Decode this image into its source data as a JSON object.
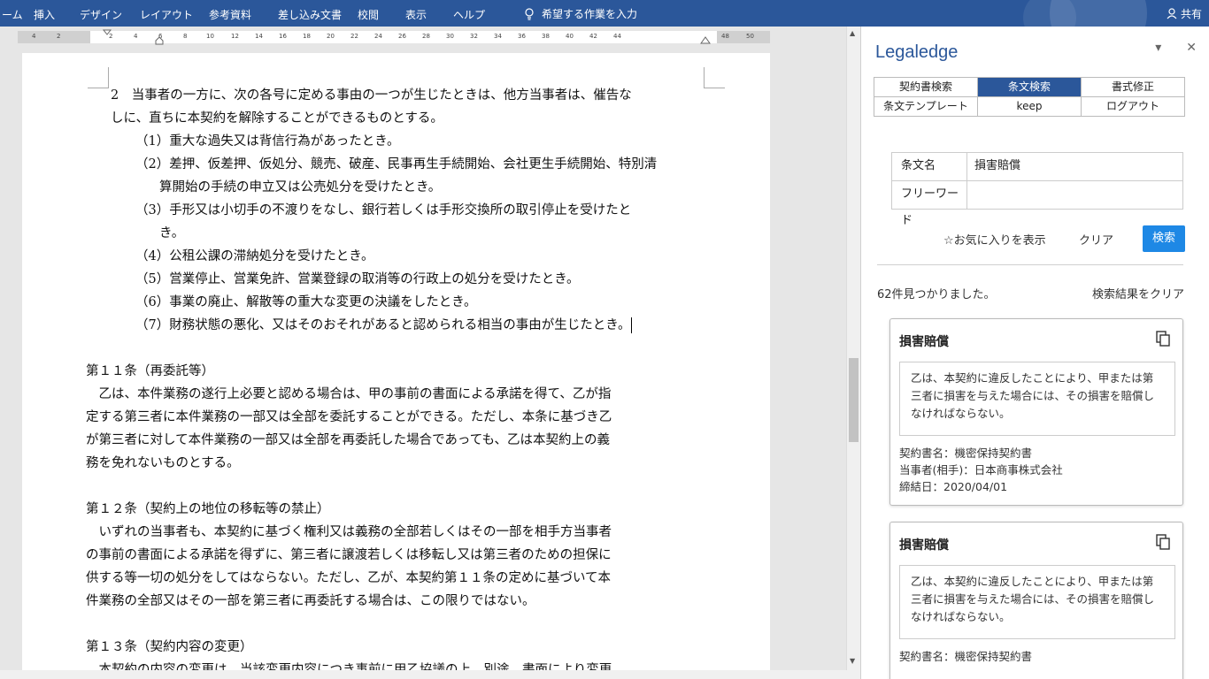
{
  "ribbon": {
    "tabs": [
      "ーム",
      "挿入",
      "デザイン",
      "レイアウト",
      "参考資料",
      "差し込み文書",
      "校閲",
      "表示",
      "ヘルプ"
    ],
    "tell_me": "希望する作業を入力",
    "share": "共有"
  },
  "ruler": {
    "ticks": [
      "4",
      "2",
      "2",
      "4",
      "6",
      "8",
      "10",
      "12",
      "14",
      "16",
      "18",
      "20",
      "22",
      "24",
      "26",
      "28",
      "30",
      "32",
      "34",
      "36",
      "38",
      "40",
      "42",
      "44",
      "48",
      "50"
    ]
  },
  "document": {
    "p1": "2　当事者の一方に、次の各号に定める事由の一つが生じたときは、他方当事者は、催告な",
    "p1b": "しに、直ちに本契約を解除することができるものとする。",
    "i1": "（1）重大な過失又は背信行為があったとき。",
    "i2a": "（2）差押、仮差押、仮処分、競売、破産、民事再生手続開始、会社更生手続開始、特別清",
    "i2b": "算開始の手続の申立又は公売処分を受けたとき。",
    "i3a": "（3）手形又は小切手の不渡りをなし、銀行若しくは手形交換所の取引停止を受けたと",
    "i3b": "き。",
    "i4": "（4）公租公課の滞納処分を受けたとき。",
    "i5": "（5）営業停止、営業免許、営業登録の取消等の行政上の処分を受けたとき。",
    "i6": "（6）事業の廃止、解散等の重大な変更の決議をしたとき。",
    "i7": "（7）財務状態の悪化、又はそのおそれがあると認められる相当の事由が生じたとき。",
    "a11_title": "第１１条（再委託等）",
    "a11_l1": "　乙は、本件業務の遂行上必要と認める場合は、甲の事前の書面による承諾を得て、乙が指",
    "a11_l2": "定する第三者に本件業務の一部又は全部を委託することができる。ただし、本条に基づき乙",
    "a11_l3": "が第三者に対して本件業務の一部又は全部を再委託した場合であっても、乙は本契約上の義",
    "a11_l4": "務を免れないものとする。",
    "a12_title": "第１２条（契約上の地位の移転等の禁止）",
    "a12_l1": "　いずれの当事者も、本契約に基づく権利又は義務の全部若しくはその一部を相手方当事者",
    "a12_l2": "の事前の書面による承諾を得ずに、第三者に譲渡若しくは移転し又は第三者のための担保に",
    "a12_l3": "供する等一切の処分をしてはならない。ただし、乙が、本契約第１１条の定めに基づいて本",
    "a12_l4": "件業務の全部又はその一部を第三者に再委託する場合は、この限りではない。",
    "a13_title": "第１３条（契約内容の変更）",
    "a13_l1": "　本契約の内容の変更は、当該変更内容につき事前に甲乙協議の上、別途、書面により変更"
  },
  "pane": {
    "title": "Legaledge",
    "tabs": [
      "契約書検索",
      "条文検索",
      "書式修正",
      "条文テンプレート",
      "keep",
      "ログアウト"
    ],
    "active_tab": 1,
    "form": {
      "name_label": "条文名",
      "name_value": "損害賠償",
      "keyword_label": "フリーワード",
      "keyword_value": ""
    },
    "fav_label": "☆お気に入りを表示",
    "clear_label": "クリア",
    "search_label": "検索",
    "count_text": "62件見つかりました。",
    "clear_results_label": "検索結果をクリア",
    "results": [
      {
        "title": "損害賠償",
        "body": "乙は、本契約に違反したことにより、甲または第三者に損害を与えた場合には、その損害を賠償しなければならない。",
        "meta": [
          "契約書名：機密保持契約書",
          "当事者(相手)：日本商事株式会社",
          "締結日：2020/04/01"
        ]
      },
      {
        "title": "損害賠償",
        "body": "乙は、本契約に違反したことにより、甲または第三者に損害を与えた場合には、その損害を賠償しなければならない。",
        "meta": [
          "契約書名：機密保持契約書"
        ]
      }
    ]
  },
  "colors": {
    "accent": "#2b579a",
    "button": "#1e88e5"
  }
}
